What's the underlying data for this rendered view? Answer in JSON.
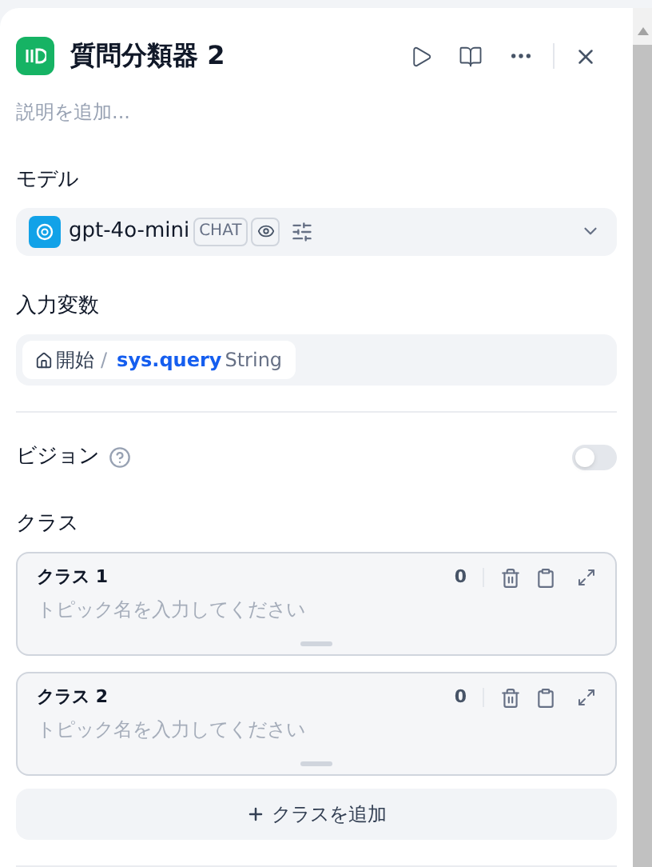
{
  "node": {
    "title": "質問分類器 2",
    "description_placeholder": "説明を追加..."
  },
  "model": {
    "label": "モデル",
    "name": "gpt-4o-mini",
    "mode": "CHAT"
  },
  "input": {
    "label": "入力変数",
    "node": "開始",
    "separator": "/",
    "variable": "sys.query",
    "type": "String"
  },
  "vision": {
    "label": "ビジョン",
    "on": false
  },
  "classes": {
    "label": "クラス",
    "items": [
      {
        "name": "クラス 1",
        "placeholder": "トピック名を入力してください",
        "count": "0"
      },
      {
        "name": "クラス 2",
        "placeholder": "トピック名を入力してください",
        "count": "0"
      }
    ]
  },
  "add_button": "クラスを追加"
}
